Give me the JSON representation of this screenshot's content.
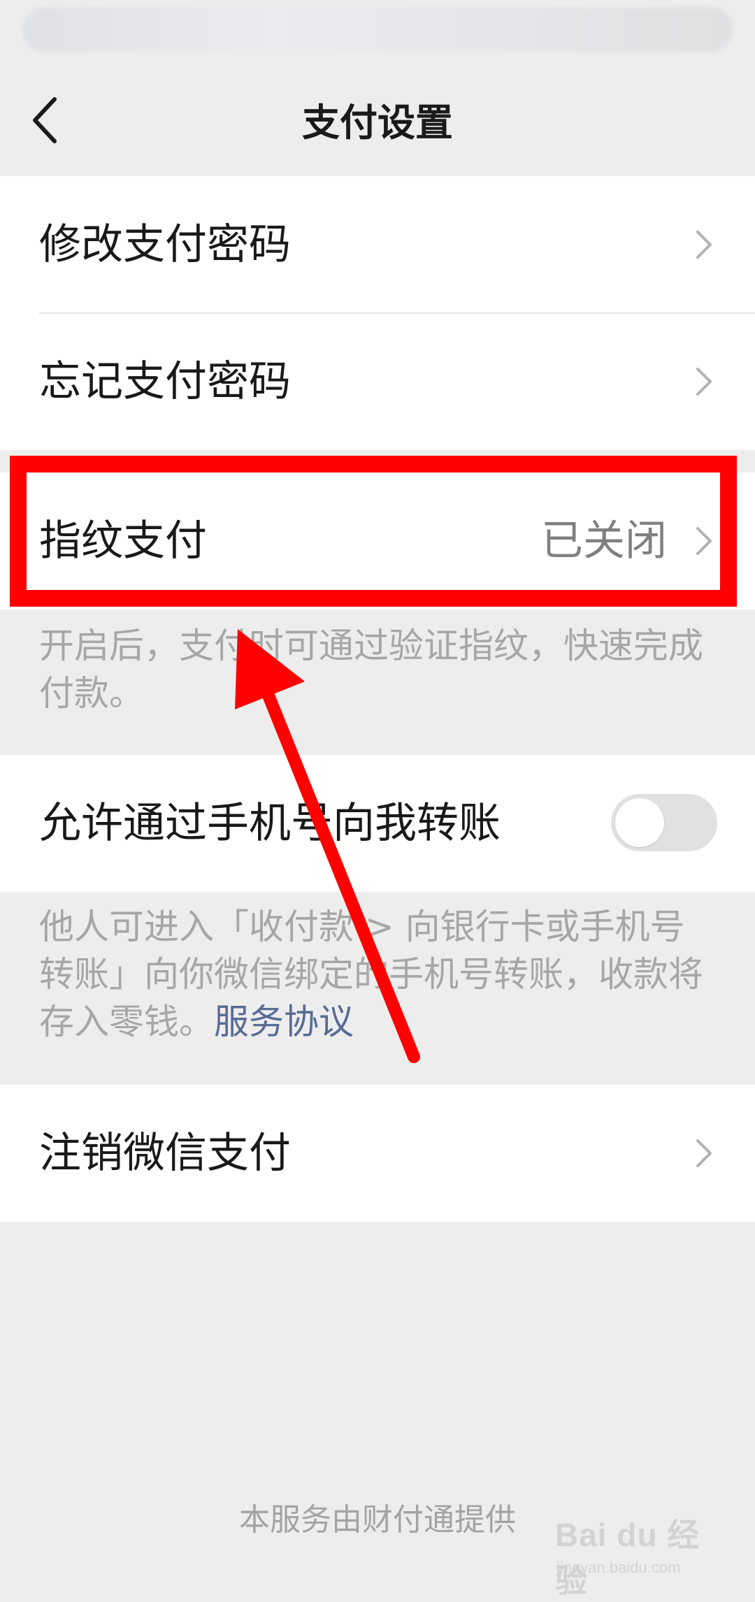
{
  "nav": {
    "title": "支付设置",
    "back_icon": "chevron-left-icon"
  },
  "password_group": {
    "items": [
      {
        "label": "修改支付密码"
      },
      {
        "label": "忘记支付密码"
      }
    ]
  },
  "fingerprint": {
    "label": "指纹支付",
    "status": "已关闭",
    "note": "开启后，支付时可通过验证指纹，快速完成付款。"
  },
  "phone_transfer": {
    "label": "允许通过手机号向我转账",
    "toggle_on": false,
    "note": "他人可进入「收付款 > 向银行卡或手机号转账」向你微信绑定的手机号转账，收款将存入零钱。",
    "link": "服务协议"
  },
  "deregister": {
    "label": "注销微信支付"
  },
  "footer": "本服务由财付通提供",
  "watermark": {
    "brand": "Bai du 经验",
    "url": "jingyan.baidu.com"
  },
  "colors": {
    "background": "#ededed",
    "cell": "#ffffff",
    "link": "#576b95",
    "annotation": "#ff0000"
  }
}
